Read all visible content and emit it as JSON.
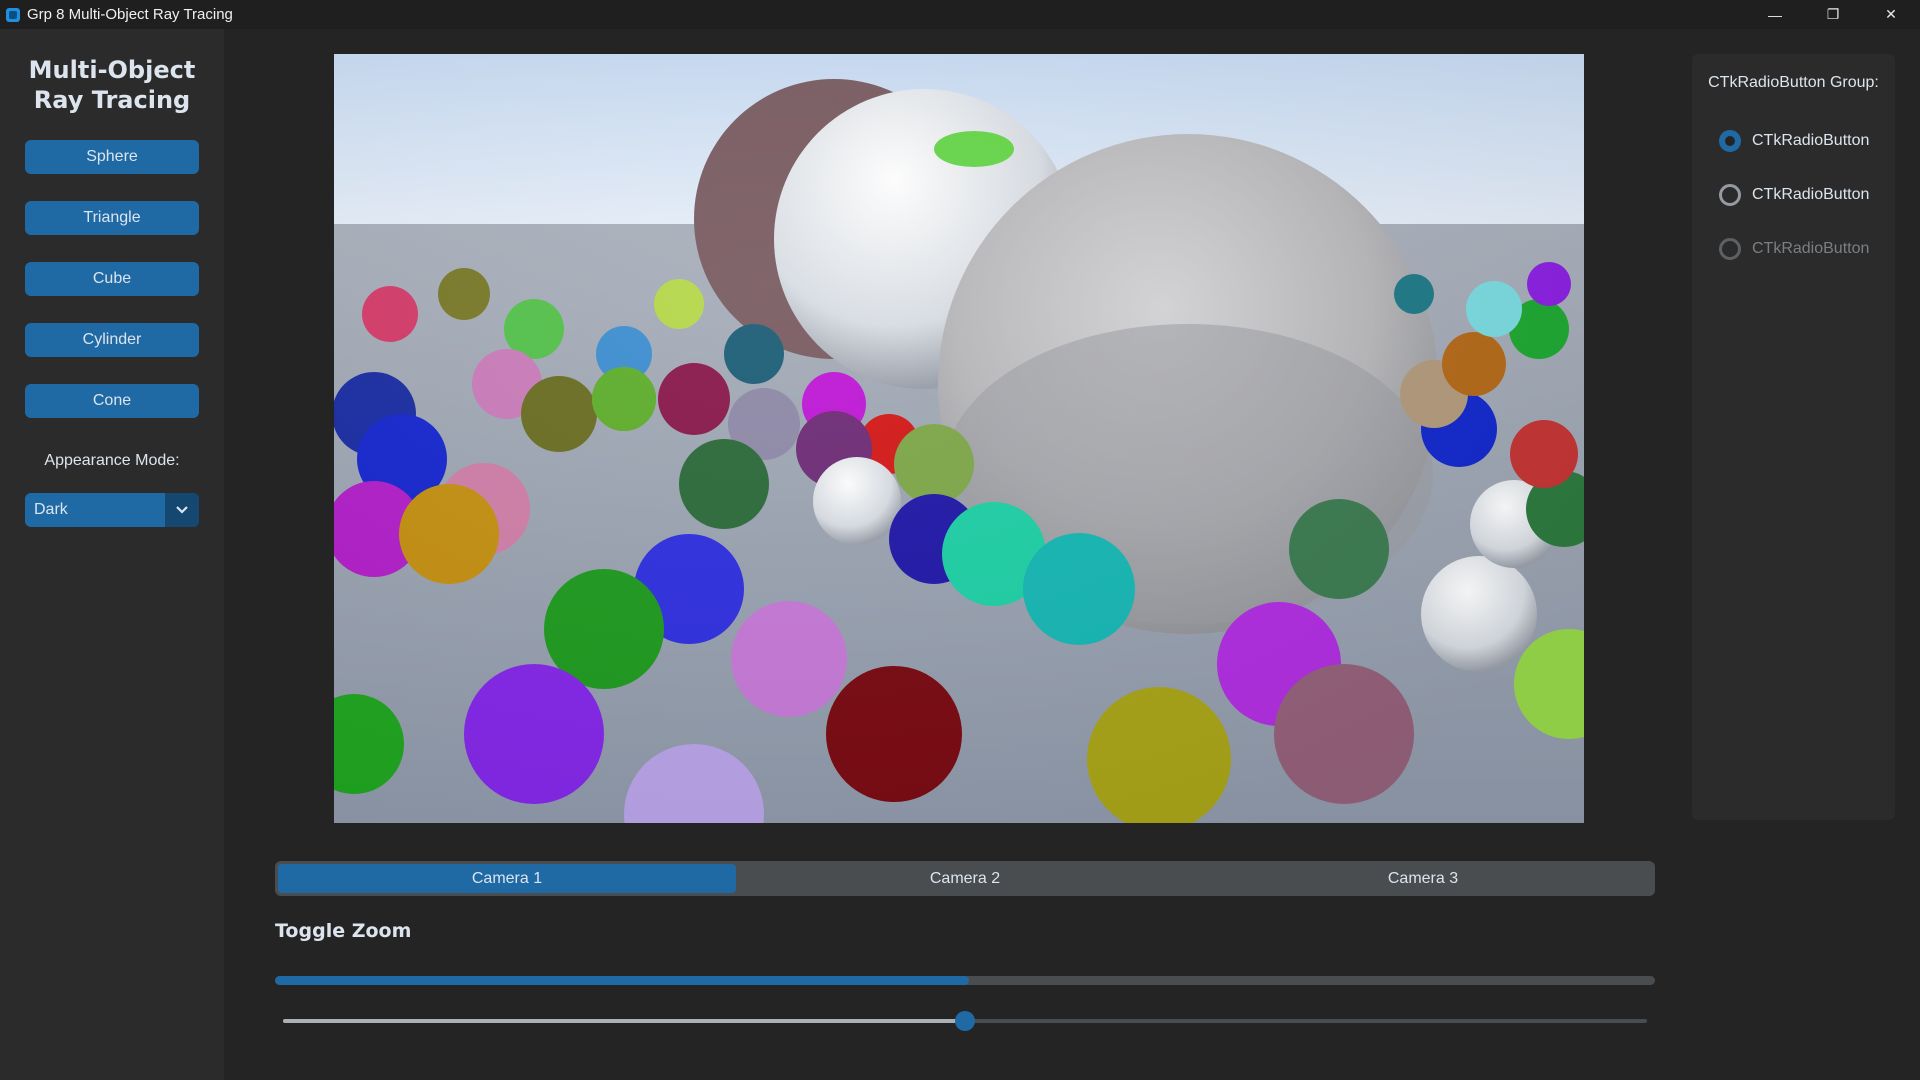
{
  "window": {
    "title": "Grp 8 Multi-Object Ray Tracing",
    "controls": {
      "minimize": "—",
      "restore": "❐",
      "close": "✕"
    }
  },
  "sidebar": {
    "logo": "Multi-Object\nRay Tracing",
    "buttons": [
      "Sphere",
      "Triangle",
      "Cube",
      "Cylinder",
      "Cone"
    ],
    "appearance_label": "Appearance Mode:",
    "appearance_value": "Dark"
  },
  "render": {
    "description_icon": "ray-traced-spheres-image"
  },
  "radio_group": {
    "title": "CTkRadioButton Group:",
    "options": [
      {
        "label": "CTkRadioButton",
        "checked": true,
        "disabled": false
      },
      {
        "label": "CTkRadioButton",
        "checked": false,
        "disabled": false
      },
      {
        "label": "CTkRadioButton",
        "checked": false,
        "disabled": true
      }
    ]
  },
  "cameras": {
    "tabs": [
      "Camera 1",
      "Camera 2",
      "Camera 3"
    ],
    "selected": "Camera 1"
  },
  "zoom": {
    "label": "Toggle Zoom",
    "progress": 0.503,
    "slider": 0.5
  },
  "colors": {
    "accent": "#1f6aa5",
    "background": "#242424",
    "panel": "#2b2b2b"
  }
}
